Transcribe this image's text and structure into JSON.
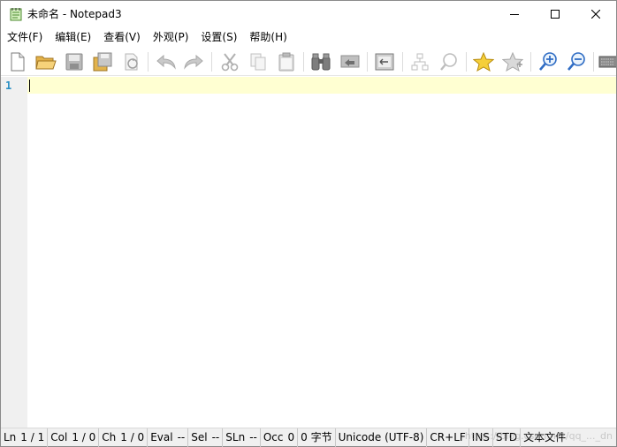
{
  "window": {
    "title": "未命名 - Notepad3",
    "controls": {
      "minimize": "minimize",
      "maximize": "maximize",
      "close": "close"
    }
  },
  "menu": {
    "items": [
      "文件(F)",
      "编辑(E)",
      "查看(V)",
      "外观(P)",
      "设置(S)",
      "帮助(H)"
    ]
  },
  "toolbar": {
    "buttons": [
      "new-file",
      "open-folder",
      "save",
      "save-as",
      "revert",
      "undo",
      "redo",
      "cut",
      "copy",
      "paste",
      "find",
      "replace",
      "word-wrap",
      "filter",
      "zoom-view",
      "add-favorite",
      "manage-favorites",
      "zoom-in",
      "zoom-out",
      "customize"
    ]
  },
  "editor": {
    "line_numbers": [
      "1"
    ],
    "colors": {
      "gutter": "#f0f0f0",
      "current_line": "#ffffd2",
      "line_number": "#2a8fc4"
    }
  },
  "status": {
    "ln_label": "Ln",
    "ln_value": "1 / 1",
    "col_label": "Col",
    "col_value": "1 / 0",
    "ch_label": "Ch",
    "ch_value": "1 / 0",
    "eval_label": "Eval",
    "eval_value": "--",
    "sel_label": "Sel",
    "sel_value": "--",
    "sln_label": "SLn",
    "sln_value": "--",
    "occ_label": "Occ",
    "occ_value": "0",
    "bytes": "0 字节",
    "encoding": "Unicode (UTF-8)",
    "eol": "CR+LF",
    "ovr": "INS",
    "mode": "STD",
    "lexer": "文本文件",
    "watermark": "https://blog.csdn.net/qq_..._dn"
  }
}
